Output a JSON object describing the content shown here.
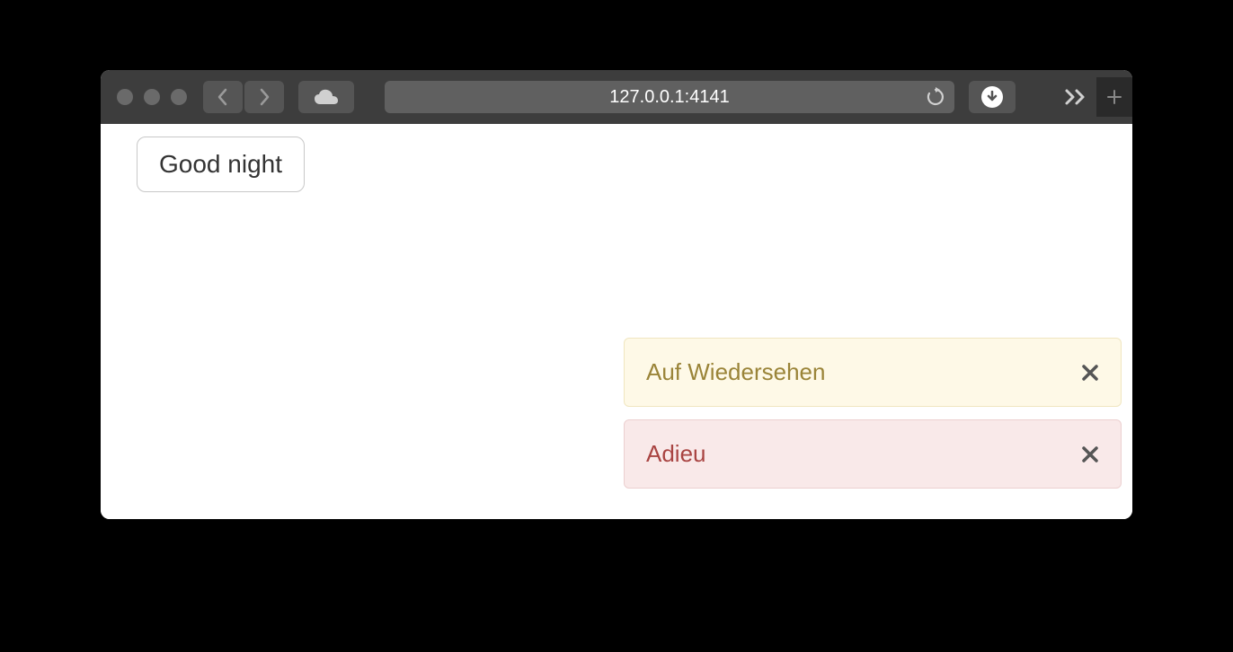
{
  "browser": {
    "address": "127.0.0.1:4141"
  },
  "page": {
    "button_label": "Good night"
  },
  "toasts": [
    {
      "type": "warning",
      "message": "Auf Wiedersehen"
    },
    {
      "type": "error",
      "message": "Adieu"
    }
  ]
}
